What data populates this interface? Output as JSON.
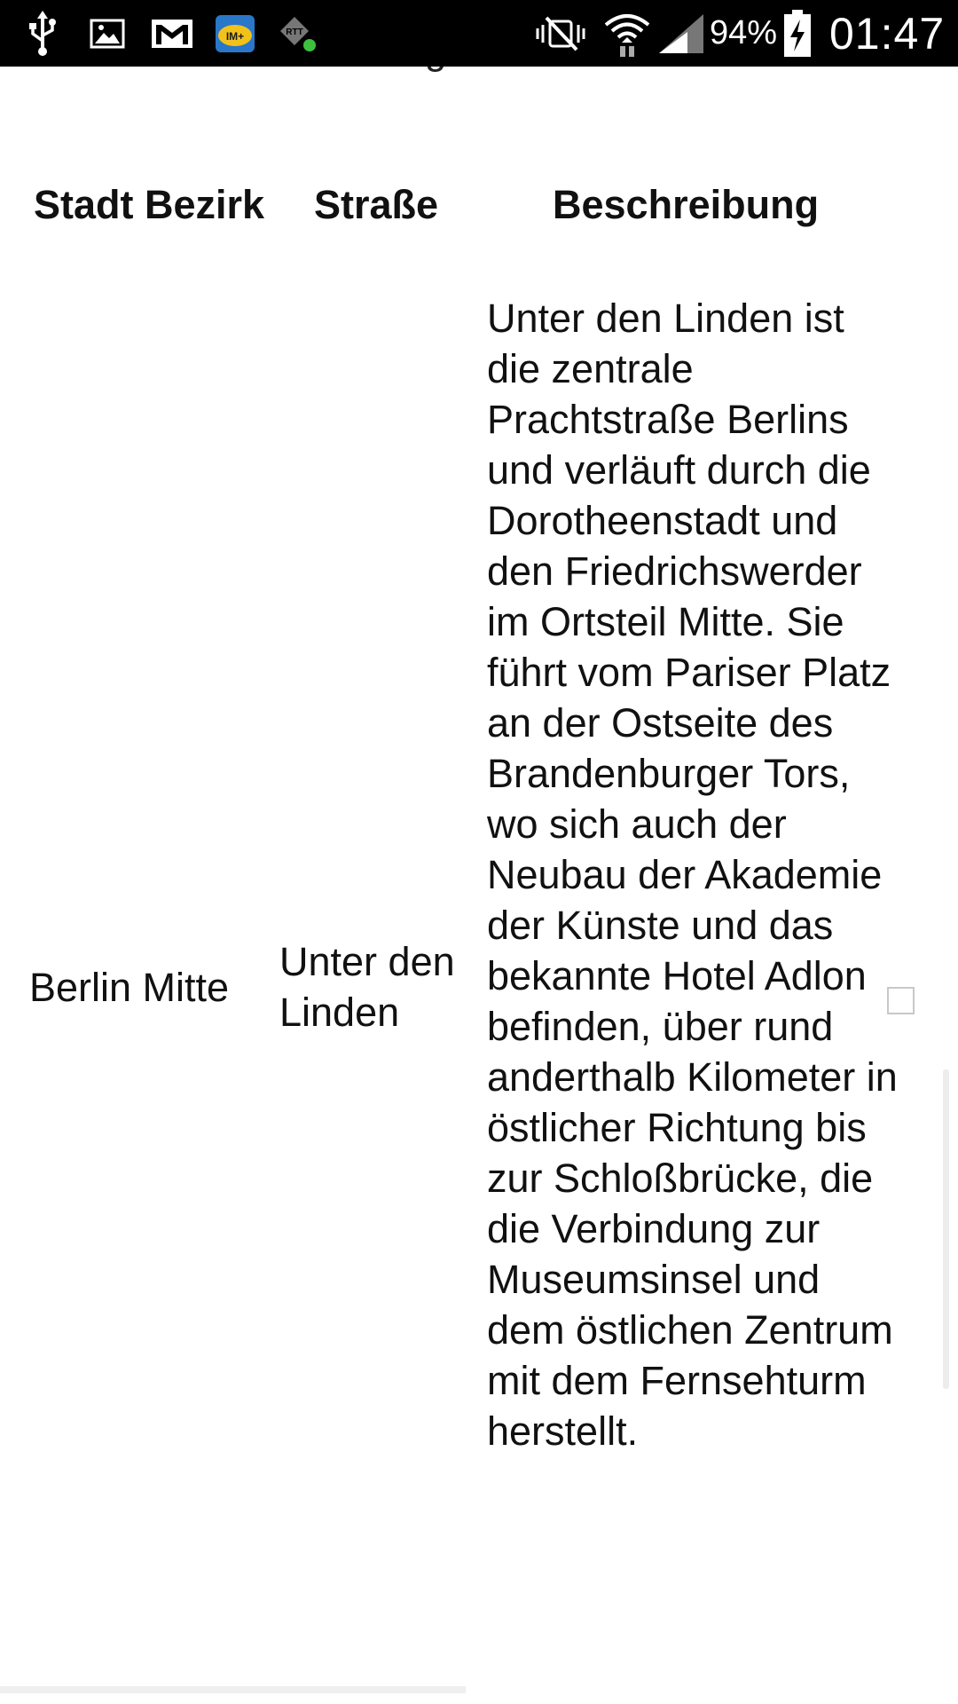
{
  "status_bar": {
    "battery_percent": "94%",
    "clock": "01:47",
    "icons": [
      "usb-icon",
      "gallery-icon",
      "gmail-icon",
      "imo-icon",
      "rtt-icon",
      "mute-icon",
      "wifi-icon",
      "signal-icon",
      "battery-charging-icon"
    ]
  },
  "page": {
    "cutoff_text": "Hier wurde das Bild aufgenommen"
  },
  "table": {
    "headers": {
      "stadt_bezirk": "Stadt Bezirk",
      "strasse": "Straße",
      "beschreibung": "Beschreibung"
    },
    "rows": [
      {
        "stadt_bezirk": "Berlin Mitte",
        "strasse": "Unter den Linden",
        "beschreibung": "Unter den Linden ist die zentrale Prachtstraße Berlins und verläuft durch die Dorotheenstadt und den Friedrichswerder im Ortsteil Mitte. Sie führt vom Pariser Platz an der Ostseite des Brandenburger Tors, wo sich auch der Neubau der Akademie der Künste und das bekannte Hotel Adlon befinden, über rund anderthalb Kilometer in östlicher Richtung bis zur Schloßbrücke, die die Verbindung zur Museumsinsel und dem östlichen Zentrum mit dem Fernsehturm herstellt.",
        "selected": false
      }
    ]
  },
  "colors": {
    "status_bar_bg": "#000000",
    "page_bg": "#ffffff",
    "text": "#111111",
    "checkbox_border": "#c8c8c8"
  }
}
